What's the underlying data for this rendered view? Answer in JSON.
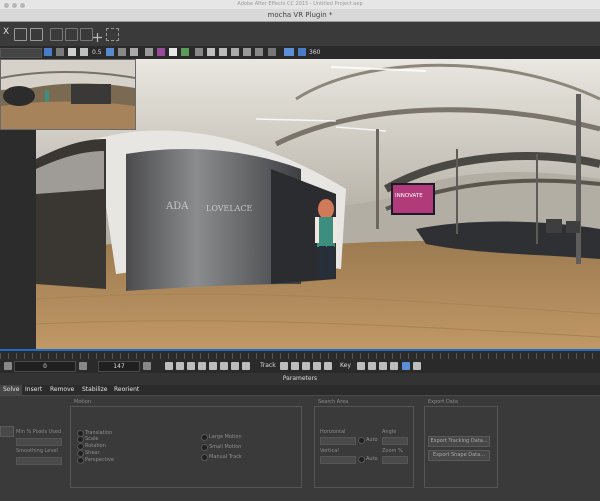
{
  "window": {
    "os_title": "Adobe After Effects CC 2015 - Untitled Project.aep",
    "plugin_title": "mocha VR Plugin *"
  },
  "toolbar": {
    "close_label": "X",
    "scale_value": "0.5",
    "projection_value": "360"
  },
  "timeline": {
    "in_frame": "0",
    "out_frame": "147",
    "track_label": "Track",
    "key_label": "Key"
  },
  "parameters": {
    "title": "Parameters",
    "tabs": [
      "Solve",
      "Insert",
      "Remove",
      "Stabilize",
      "Reorient"
    ],
    "motion_group": "Motion",
    "motion_options": [
      "Translation",
      "Scale",
      "Rotation",
      "Shear",
      "Perspective"
    ],
    "layer_options": [
      "Large Motion",
      "Small Motion",
      "Manual Track"
    ],
    "min_pixels_label": "Min % Pixels Used",
    "smoothing_label": "Smoothing Level",
    "search_area_group": "Search Area",
    "horizontal_label": "Horizontal",
    "vertical_label": "Vertical",
    "angle_label": "Angle",
    "zoom_label": "Zoom %",
    "auto_label": "Auto",
    "export_group": "Export Data",
    "export_tracking_button": "Export Tracking Data...",
    "export_shape_button": "Export Shape Data..."
  },
  "viewer": {
    "sign_ada": "ADA",
    "sign_lovelace": "LOVELACE",
    "screen_text": "INNOVATE"
  },
  "colors": {
    "timeline_accent": "#1c6cc8",
    "toolbar_bg": "#3a3a3a",
    "panel_bg": "#3a3a3a"
  }
}
